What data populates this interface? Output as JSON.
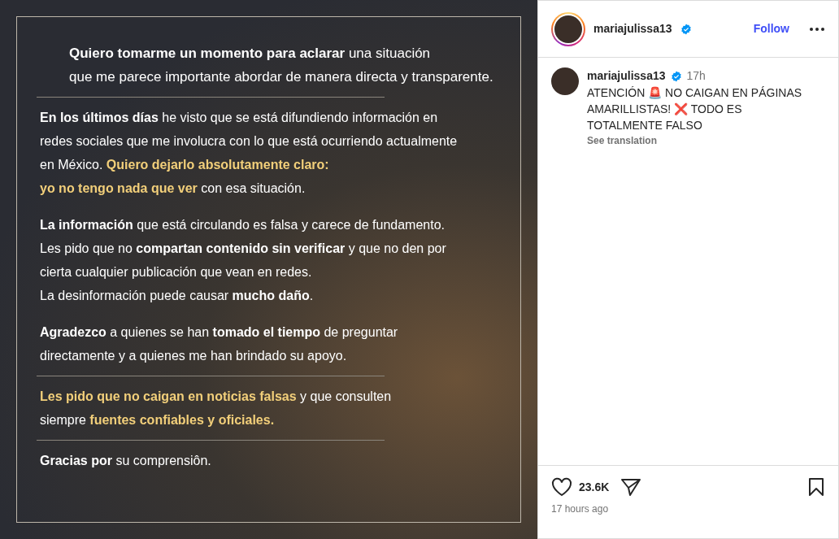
{
  "post_image": {
    "blocks": [
      {
        "kind": "paragraph",
        "indent": true,
        "lines": [
          [
            {
              "kind": "bold",
              "text": "Quiero tomarme un momento para aclarar"
            },
            {
              "kind": "plain",
              "text": " una situación"
            }
          ],
          [
            {
              "kind": "plain",
              "text": "que me parece importante abordar de manera directa y transparente."
            }
          ]
        ]
      },
      {
        "kind": "divider"
      },
      {
        "kind": "paragraph",
        "indent": false,
        "lines": [
          [
            {
              "kind": "bold",
              "text": "En los últimos días"
            },
            {
              "kind": "plain",
              "text": " he visto que se está difundiendo información en"
            }
          ],
          [
            {
              "kind": "plain",
              "text": "redes sociales que me involucra con lo que está ocurriendo actualmente"
            }
          ],
          [
            {
              "kind": "plain",
              "text": "en México. "
            },
            {
              "kind": "gold",
              "text": "Quiero dejarlo absolutamente claro:"
            }
          ],
          [
            {
              "kind": "gold",
              "text": "yo no tengo nada que ver"
            },
            {
              "kind": "plain",
              "text": " con esa situación."
            }
          ]
        ]
      },
      {
        "kind": "paragraph",
        "indent": false,
        "lines": [
          [
            {
              "kind": "bold",
              "text": "La información"
            },
            {
              "kind": "plain",
              "text": " que está circulando es falsa y carece de fundamento."
            }
          ],
          [
            {
              "kind": "plain",
              "text": "Les pido que no "
            },
            {
              "kind": "bold",
              "text": "compartan contenido sin verificar"
            },
            {
              "kind": "plain",
              "text": " y que no den por"
            }
          ],
          [
            {
              "kind": "plain",
              "text": "cierta cualquier publicación que vean en redes."
            }
          ],
          [
            {
              "kind": "plain",
              "text": "La desinformación puede causar "
            },
            {
              "kind": "bold",
              "text": "mucho daño"
            },
            {
              "kind": "plain",
              "text": "."
            }
          ]
        ]
      },
      {
        "kind": "paragraph",
        "indent": false,
        "lines": [
          [
            {
              "kind": "bold",
              "text": "Agradezco"
            },
            {
              "kind": "plain",
              "text": " a quienes se han "
            },
            {
              "kind": "bold",
              "text": "tomado el tiempo"
            },
            {
              "kind": "plain",
              "text": " de preguntar"
            }
          ],
          [
            {
              "kind": "plain",
              "text": "directamente y a quienes me han brindado su apoyo."
            }
          ]
        ]
      },
      {
        "kind": "divider"
      },
      {
        "kind": "paragraph",
        "indent": false,
        "lines": [
          [
            {
              "kind": "gold",
              "text": "Les pido que no caigan en noticias falsas"
            },
            {
              "kind": "plain",
              "text": " y que consulten"
            }
          ],
          [
            {
              "kind": "plain",
              "text": "siempre "
            },
            {
              "kind": "gold",
              "text": "fuentes confiables y oficiales."
            }
          ]
        ]
      },
      {
        "kind": "divider"
      },
      {
        "kind": "paragraph",
        "indent": false,
        "lines": [
          [
            {
              "kind": "bold",
              "text": "Gracias"
            },
            {
              "kind": "bold",
              "text": " por"
            },
            {
              "kind": "plain",
              "text": " su comprensiôn."
            }
          ]
        ]
      }
    ]
  },
  "header": {
    "username": "mariajulissa13",
    "verified": true,
    "follow": "Follow"
  },
  "caption": {
    "username": "mariajulissa13",
    "verified": true,
    "time": "17h",
    "text": "ATENCIÓN 🚨 NO CAIGAN EN PÁGINAS AMARILLISTAS! ❌ TODO ES TOTALMENTE FALSO",
    "translate": "See translation"
  },
  "actions": {
    "liked": false,
    "likes": "23.6K",
    "saved": false,
    "date": "17 hours ago"
  }
}
